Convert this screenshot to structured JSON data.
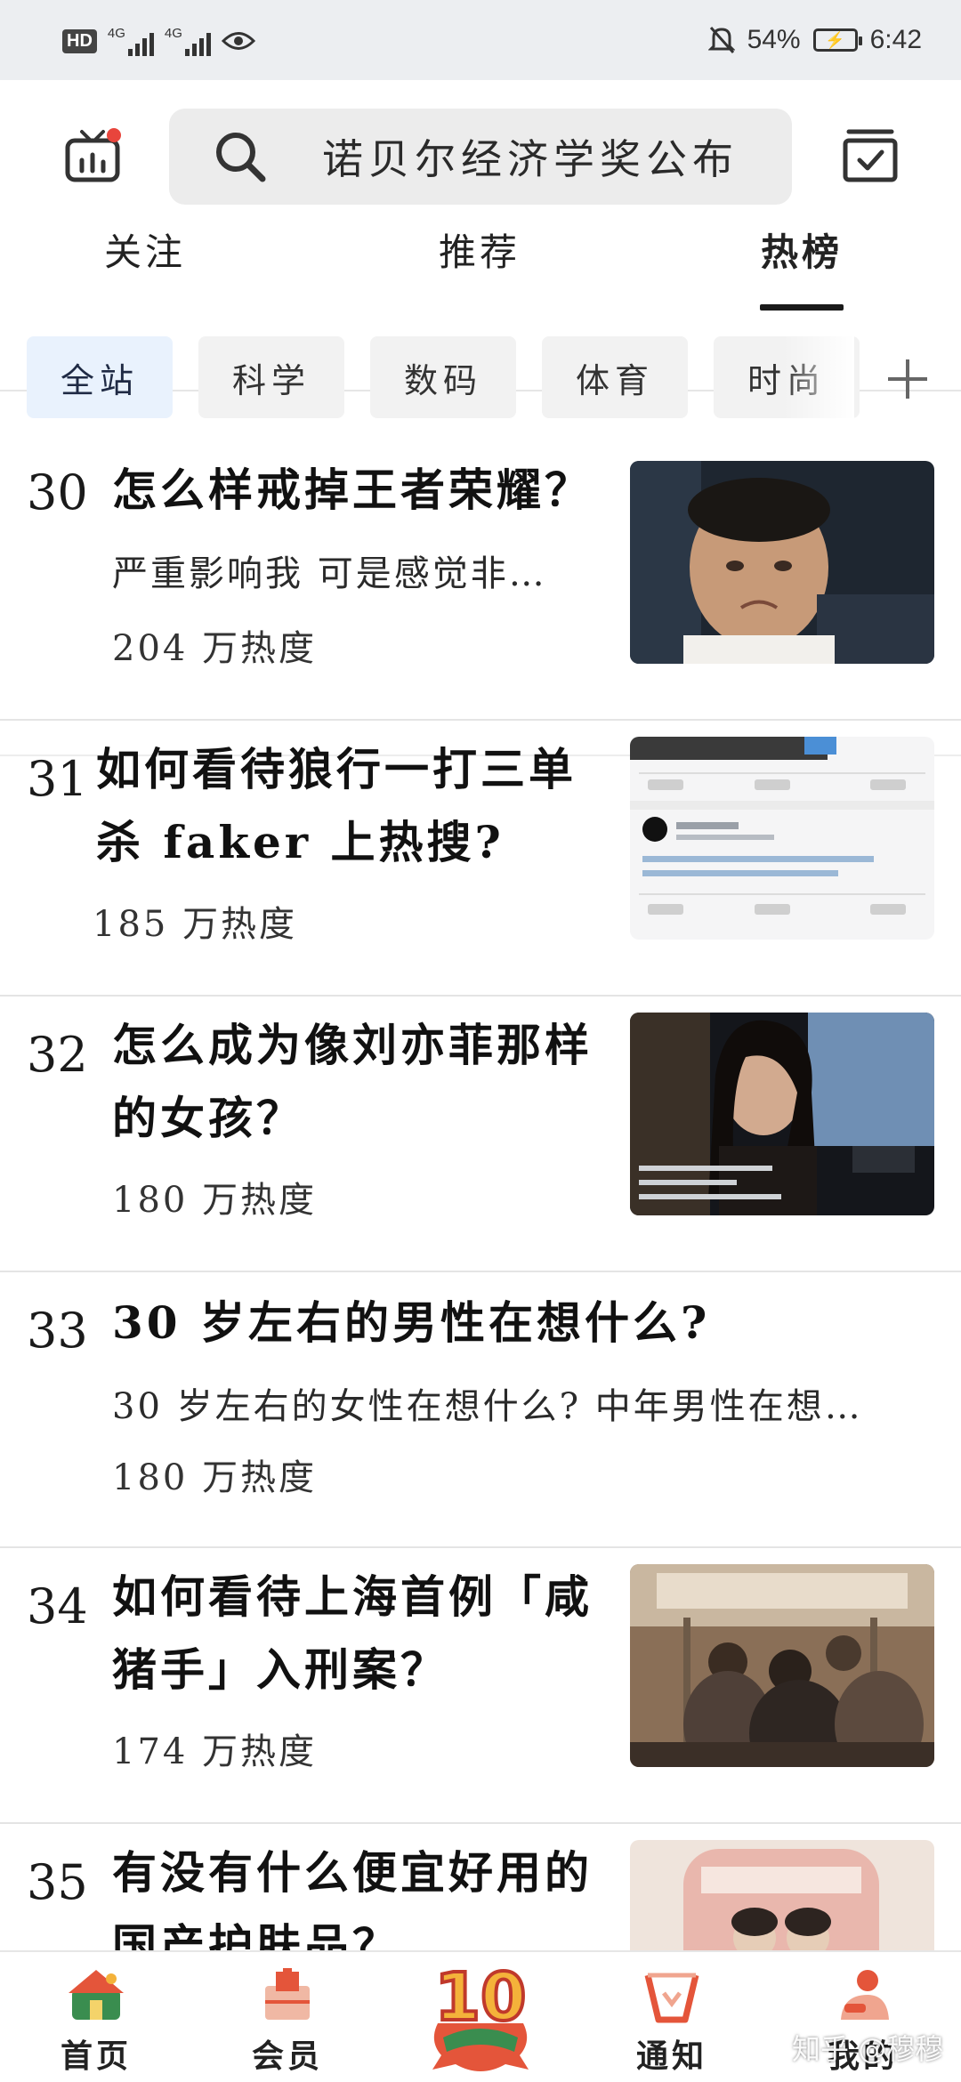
{
  "status_bar": {
    "hd_label": "HD",
    "network_1": "4G",
    "network_2": "4G",
    "battery_percent": "54%",
    "time": "6:42"
  },
  "header": {
    "search_text": "诺贝尔经济学奖公布",
    "tabs": [
      {
        "label": "关注"
      },
      {
        "label": "推荐"
      },
      {
        "label": "热榜"
      }
    ],
    "active_tab": "热榜"
  },
  "categories": [
    {
      "label": "全站"
    },
    {
      "label": "科学"
    },
    {
      "label": "数码"
    },
    {
      "label": "体育"
    },
    {
      "label": "时尚"
    }
  ],
  "hot_list": [
    {
      "rank": "30",
      "title": "怎么样戒掉王者荣耀？",
      "excerpt": "严重影响我 可是感觉非…",
      "heat": "204 万热度",
      "thumb": "kid-photo"
    },
    {
      "rank": "31",
      "title_line1": "如何看待狼行一打三单",
      "title_line2": "杀 faker 上热搜?",
      "heat": "185 万热度",
      "thumb": "comment-screenshot"
    },
    {
      "rank": "32",
      "title_line1": "怎么成为像刘亦菲那样",
      "title_line2": "的女孩？",
      "heat": "180 万热度",
      "thumb": "movie-still"
    },
    {
      "rank": "33",
      "title": "30 岁左右的男性在想什么?",
      "excerpt": "30 岁左右的女性在想什么? 中年男性在想…",
      "heat": "180 万热度"
    },
    {
      "rank": "34",
      "title_line1": "如何看待上海首例「咸",
      "title_line2": "猪手」入刑案？",
      "heat": "174 万热度",
      "thumb": "subway-photo"
    },
    {
      "rank": "35",
      "title_line1": "有没有什么便宜好用的",
      "title_line2": "国产护肤品？",
      "thumb": "product-photo"
    }
  ],
  "bottom_nav": [
    {
      "label": "首页",
      "icon": "home-icon"
    },
    {
      "label": "会员",
      "icon": "member-icon"
    },
    {
      "label": "通知",
      "icon": "bell-icon"
    },
    {
      "label": "我的",
      "icon": "profile-icon"
    }
  ],
  "anniversary_badge": "10",
  "watermark": "知乎 @穆穆",
  "colors": {
    "active_chip_bg": "#e9f2fd",
    "nav_accent": "#e4553a",
    "notification_dot": "#e8453c"
  }
}
